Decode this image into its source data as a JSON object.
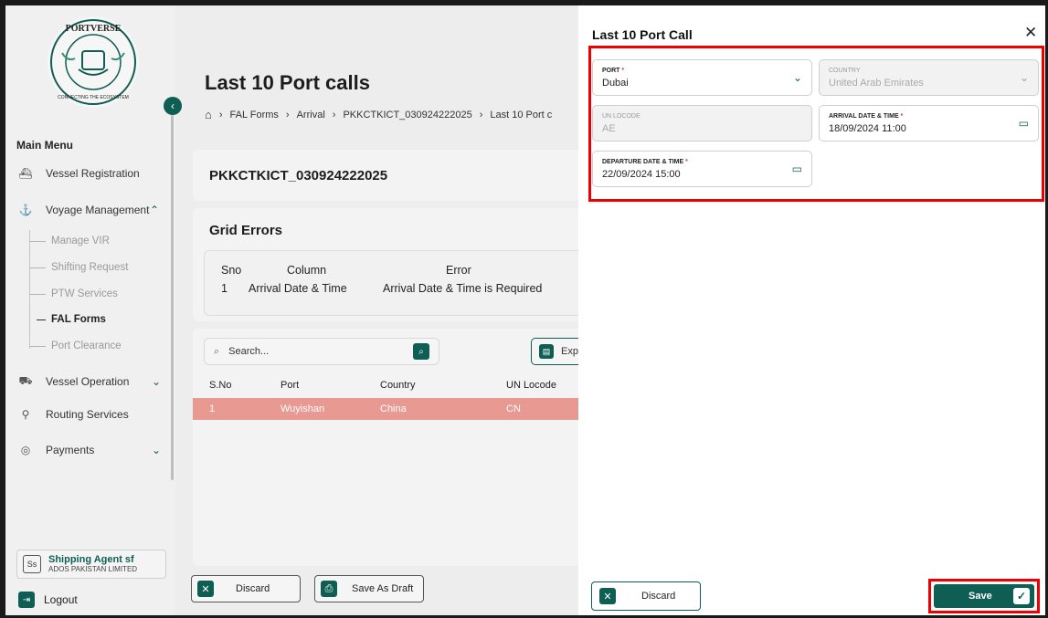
{
  "sidebar": {
    "menu_title": "Main Menu",
    "items": [
      {
        "label": "Vessel Registration",
        "icon": "ship-icon"
      },
      {
        "label": "Voyage Management",
        "icon": "anchor-icon"
      },
      {
        "label": "Vessel Operation",
        "icon": "crane-icon"
      },
      {
        "label": "Routing Services",
        "icon": "route-icon"
      },
      {
        "label": "Payments",
        "icon": "payment-icon"
      }
    ],
    "sub_items": [
      "Manage VIR",
      "Shifting Request",
      "PTW Services",
      "FAL Forms",
      "Port Clearance"
    ],
    "agent": {
      "initials": "Ss",
      "name": "Shipping Agent sf",
      "company": "ADOS PAKISTAN LIMITED"
    },
    "logout": "Logout"
  },
  "main": {
    "title": "Last 10 Port calls",
    "breadcrumb": [
      "FAL Forms",
      "Arrival",
      "PKKCTKICT_030924222025",
      "Last 10 Port c"
    ],
    "vir_id": "PKKCTKICT_030924222025",
    "grid_errors": {
      "title": "Grid Errors",
      "headers": [
        "Sno",
        "Column",
        "Error"
      ],
      "row": [
        "1",
        "Arrival Date & Time",
        "Arrival Date & Time is Required"
      ]
    },
    "search_placeholder": "Search...",
    "export_label": "Expo",
    "table": {
      "headers": [
        "S.No",
        "Port",
        "Country",
        "UN Locode"
      ],
      "row": [
        "1",
        "Wuyishan",
        "China",
        "CN"
      ]
    },
    "discard": "Discard",
    "save_draft": "Save As Draft"
  },
  "panel": {
    "title": "Last 10 Port Call",
    "port": {
      "label": "PORT",
      "value": "Dubai"
    },
    "country": {
      "label": "COUNTRY",
      "value": "United Arab Emirates"
    },
    "locode": {
      "label": "UN LOCODE",
      "value": "AE"
    },
    "arrival": {
      "label": "ARRIVAL DATE & TIME",
      "value": "18/09/2024 11:00"
    },
    "departure": {
      "label": "DEPARTURE DATE & TIME",
      "value": "22/09/2024 15:00"
    },
    "discard": "Discard",
    "save": "Save"
  },
  "colors": {
    "accent": "#0f5e53",
    "highlight": "#e00000",
    "error_row": "#e89a92"
  }
}
